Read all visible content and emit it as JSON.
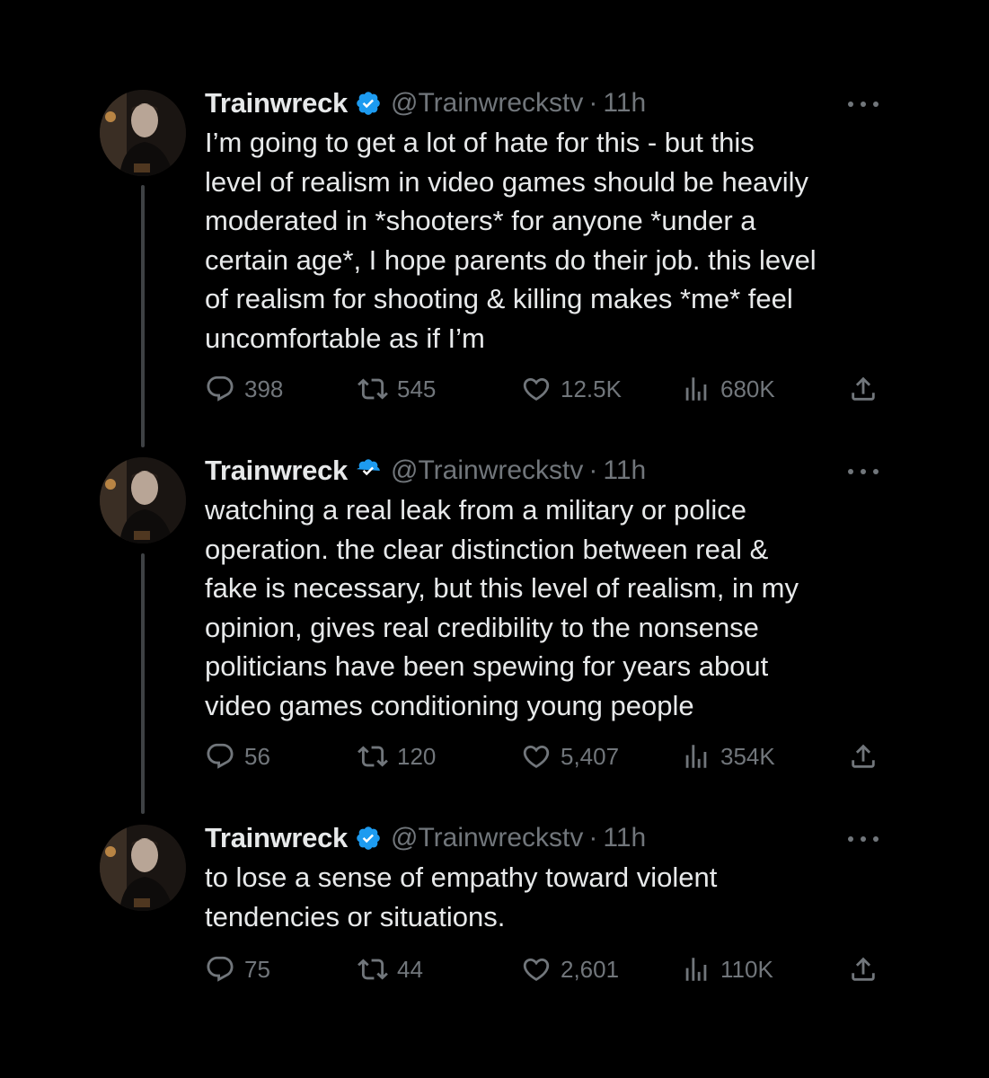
{
  "tweets": [
    {
      "name": "Trainwreck",
      "handle": "@Trainwreckstv",
      "separator": "·",
      "time": "11h",
      "text": "I’m going to get a lot of hate for this - but this\nlevel of realism in video games should be heavily\nmoderated in *shooters* for anyone *under a\ncertain age*, I hope parents do their job. this level\nof realism for shooting & killing makes *me* feel\nuncomfortable as if I’m",
      "replies": "398",
      "retweets": "545",
      "likes": "12.5K",
      "views": "680K"
    },
    {
      "name": "Trainwreck",
      "handle": "@Trainwreckstv",
      "separator": "·",
      "time": "11h",
      "text": "watching a real leak from a military or police\noperation. the clear distinction between real &\nfake is necessary, but this level of realism, in my\nopinion, gives real credibility to the nonsense\npoliticians have been spewing for years about\nvideo games conditioning young people",
      "replies": "56",
      "retweets": "120",
      "likes": "5,407",
      "views": "354K"
    },
    {
      "name": "Trainwreck",
      "handle": "@Trainwreckstv",
      "separator": "·",
      "time": "11h",
      "text": "to lose a sense of empathy toward violent\ntendencies or situations.",
      "replies": "75",
      "retweets": "44",
      "likes": "2,601",
      "views": "110K"
    }
  ],
  "icons": {
    "verified": "verified-badge-icon",
    "more": "more-options-icon",
    "reply": "reply-icon",
    "retweet": "retweet-icon",
    "like": "heart-icon",
    "views": "views-chart-icon",
    "share": "share-icon"
  },
  "colors": {
    "background": "#000000",
    "text": "#e7e9ea",
    "secondary": "#71767b",
    "verified": "#1d9bf0",
    "thread_line": "#3e4144"
  }
}
